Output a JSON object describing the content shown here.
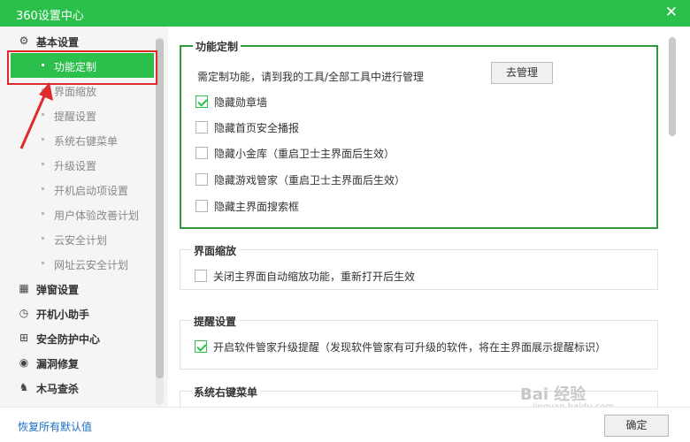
{
  "window": {
    "title": "360设置中心",
    "close_icon": "close-icon"
  },
  "sidebar": {
    "groups": [
      {
        "label": "基本设置",
        "icon": "gear-icon"
      },
      {
        "label": "弹窗设置",
        "icon": "popup-icon"
      },
      {
        "label": "开机小助手",
        "icon": "timer-icon"
      },
      {
        "label": "安全防护中心",
        "icon": "shield-grid-icon"
      },
      {
        "label": "漏洞修复",
        "icon": "patch-icon"
      },
      {
        "label": "木马查杀",
        "icon": "horse-icon"
      }
    ],
    "items": [
      {
        "label": "功能定制",
        "active": true
      },
      {
        "label": "界面缩放"
      },
      {
        "label": "提醒设置"
      },
      {
        "label": "系统右键菜单"
      },
      {
        "label": "升级设置"
      },
      {
        "label": "开机启动项设置"
      },
      {
        "label": "用户体验改善计划"
      },
      {
        "label": "云安全计划"
      },
      {
        "label": "网址云安全计划"
      }
    ]
  },
  "main": {
    "feature": {
      "title": "功能定制",
      "desc": "需定制功能，请到我的工具/全部工具中进行管理",
      "manage_button": "去管理",
      "options": [
        {
          "label": "隐藏勋章墙",
          "checked": true
        },
        {
          "label": "隐藏首页安全播报",
          "checked": false
        },
        {
          "label": "隐藏小金库（重启卫士主界面后生效）",
          "checked": false
        },
        {
          "label": "隐藏游戏管家（重启卫士主界面后生效）",
          "checked": false
        },
        {
          "label": "隐藏主界面搜索框",
          "checked": false
        }
      ]
    },
    "zoom": {
      "title": "界面缩放",
      "options": [
        {
          "label": "关闭主界面自动缩放功能，重新打开后生效",
          "checked": false
        }
      ]
    },
    "remind": {
      "title": "提醒设置",
      "options": [
        {
          "label": "开启软件管家升级提醒（发现软件管家有可升级的软件，将在主界面展示提醒标识）",
          "checked": true
        }
      ]
    },
    "context": {
      "title": "系统右键菜单"
    }
  },
  "footer": {
    "restore": "恢复所有默认值",
    "ok": "确定"
  },
  "watermark": {
    "text": "Bai 经验",
    "url": "jingyan.baidu.com"
  },
  "colors": {
    "accent": "#2bbf4c",
    "highlight_border": "#2e9a3b",
    "annotation": "#e0292c"
  }
}
